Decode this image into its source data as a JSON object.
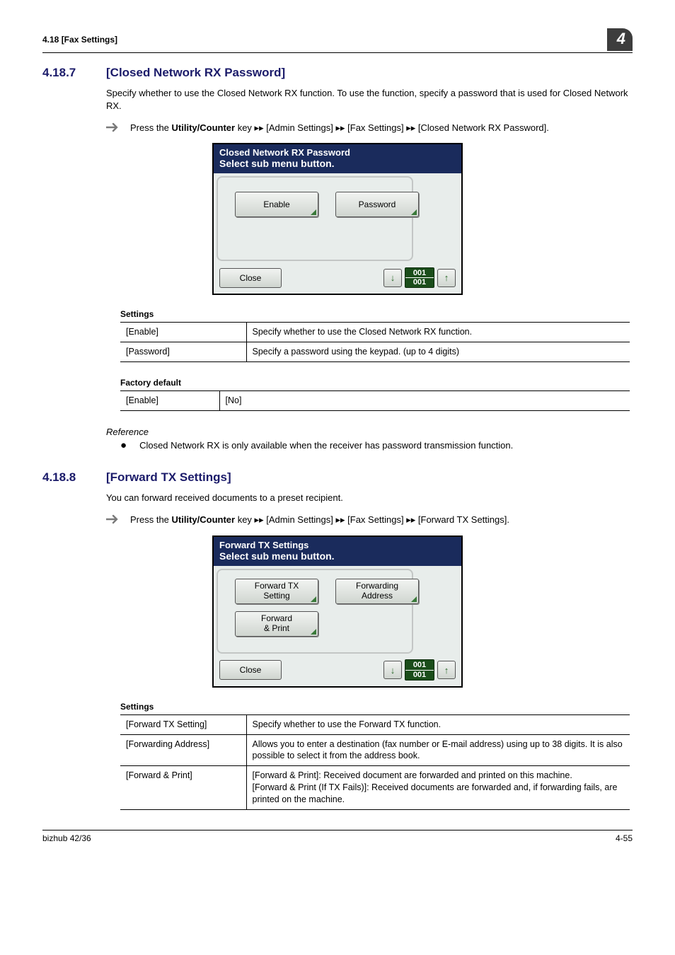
{
  "header": {
    "section_left": "4.18    [Fax Settings]",
    "chapter_badge": "4"
  },
  "s1": {
    "num": "4.18.7",
    "title": "[Closed Network RX Password]",
    "intro": "Specify whether to use the Closed Network RX function. To use the function, specify a password that is used for Closed Network RX.",
    "instr_prefix": "Press the ",
    "instr_bold": "Utility/Counter",
    "instr_suffix": " key ▸▸ [Admin Settings] ▸▸ [Fax Settings] ▸▸ [Closed Network RX Password].",
    "screen": {
      "title": "Closed Network RX Password",
      "subtitle": "Select sub menu button.",
      "btn1": "Enable",
      "btn2": "Password",
      "close": "Close",
      "page_top": "001",
      "page_bot": "001"
    },
    "settings_label": "Settings",
    "settings_rows": [
      {
        "k": "[Enable]",
        "v": "Specify whether to use the Closed Network RX function."
      },
      {
        "k": "[Password]",
        "v": "Specify a password using the keypad. (up to 4 digits)"
      }
    ],
    "factory_label": "Factory default",
    "factory_rows": [
      {
        "k": "[Enable]",
        "v": "[No]"
      }
    ],
    "reference_label": "Reference",
    "reference_item": "Closed Network RX is only available when the receiver has password transmission function."
  },
  "s2": {
    "num": "4.18.8",
    "title": "[Forward TX Settings]",
    "intro": "You can forward received documents to a preset recipient.",
    "instr_prefix": "Press the ",
    "instr_bold": "Utility/Counter",
    "instr_suffix": " key ▸▸ [Admin Settings] ▸▸ [Fax Settings] ▸▸ [Forward TX Settings].",
    "screen": {
      "title": "Forward TX Settings",
      "subtitle": "Select sub menu button.",
      "btn1": "Forward TX\nSetting",
      "btn2": "Forwarding\nAddress",
      "btn3": "Forward\n& Print",
      "close": "Close",
      "page_top": "001",
      "page_bot": "001"
    },
    "settings_label": "Settings",
    "settings_rows": [
      {
        "k": "[Forward TX Setting]",
        "v": "Specify whether to use the Forward TX function."
      },
      {
        "k": "[Forwarding Address]",
        "v": "Allows you to enter a destination (fax number or E-mail address) using up to 38 digits. It is also possible to select it from the address book."
      },
      {
        "k": "[Forward & Print]",
        "v": "[Forward & Print]: Received document are forwarded and printed on this machine.\n[Forward & Print (If TX Fails)]: Received documents are forwarded and, if forwarding fails, are printed on the machine."
      }
    ]
  },
  "footer": {
    "left": "bizhub 42/36",
    "right": "4-55"
  }
}
